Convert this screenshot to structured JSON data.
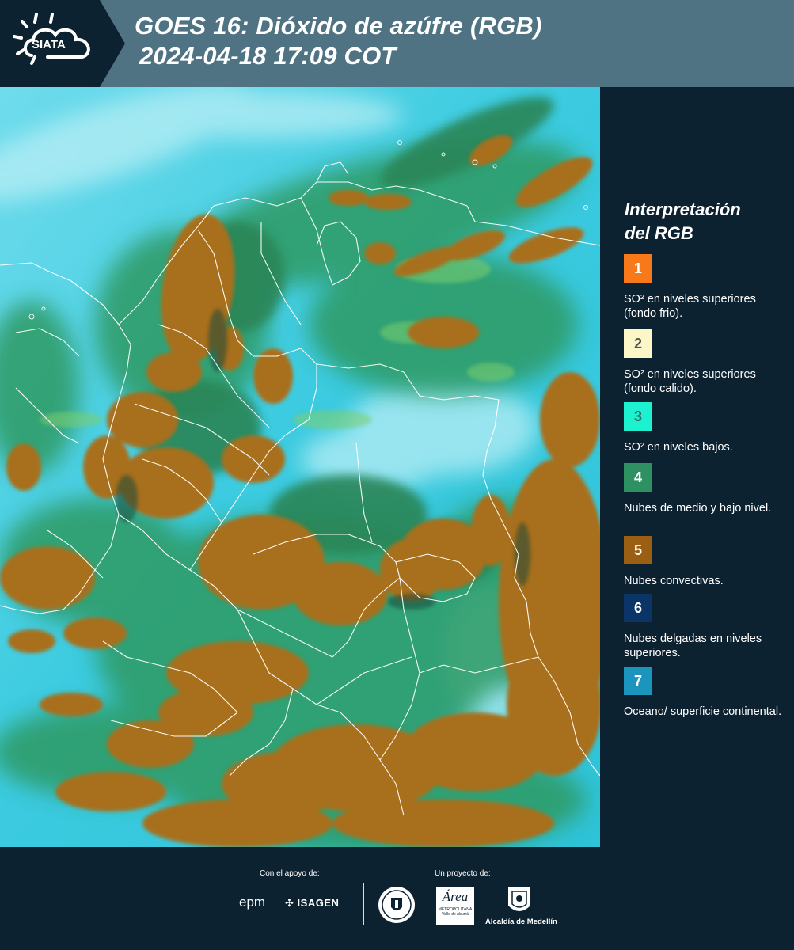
{
  "header": {
    "logo_text": "SIATA",
    "title_line1": "GOES 16: Dióxido de azúfre (RGB)",
    "title_line2": "2024-04-18 17:09 COT"
  },
  "legend": {
    "title_line1": "Interpretación",
    "title_line2": "del RGB",
    "items": [
      {
        "num": "1",
        "color": "#f7791a",
        "num_color": "#ffffff",
        "label": "SO² en niveles superiores (fondo frio)."
      },
      {
        "num": "2",
        "color": "#fdf7c8",
        "num_color": "#555555",
        "label": "SO² en niveles superiores (fondo calido)."
      },
      {
        "num": "3",
        "color": "#1df2d0",
        "num_color": "#3a6a66",
        "label": "SO² en niveles bajos."
      },
      {
        "num": "4",
        "color": "#2e9162",
        "num_color": "#ffffff",
        "label": "Nubes de medio y bajo nivel."
      },
      {
        "num": "5",
        "color": "#9a5f12",
        "num_color": "#ffffff",
        "label": "Nubes convectivas."
      },
      {
        "num": "6",
        "color": "#0b3566",
        "num_color": "#ffffff",
        "label": "Nubes delgadas en niveles superiores."
      },
      {
        "num": "7",
        "color": "#1b95be",
        "num_color": "#ffffff",
        "label": "Oceano/ superficie continental."
      }
    ]
  },
  "footer": {
    "support_label": "Con el apoyo de:",
    "project_label": "Un proyecto de:",
    "sponsor1": "epm",
    "sponsor2": "ISAGEN",
    "org1": "Área",
    "org1_sub": "METROPOLITANA",
    "org1_sub2": "Valle de Aburrá",
    "org2": "Alcaldía de Medellín"
  },
  "colors": {
    "header_bg": "#4f7383",
    "panel_bg": "#0d2230",
    "ocean": "#39c9df",
    "convective": "#a8701c",
    "mid_low": "#2f8f5e"
  }
}
